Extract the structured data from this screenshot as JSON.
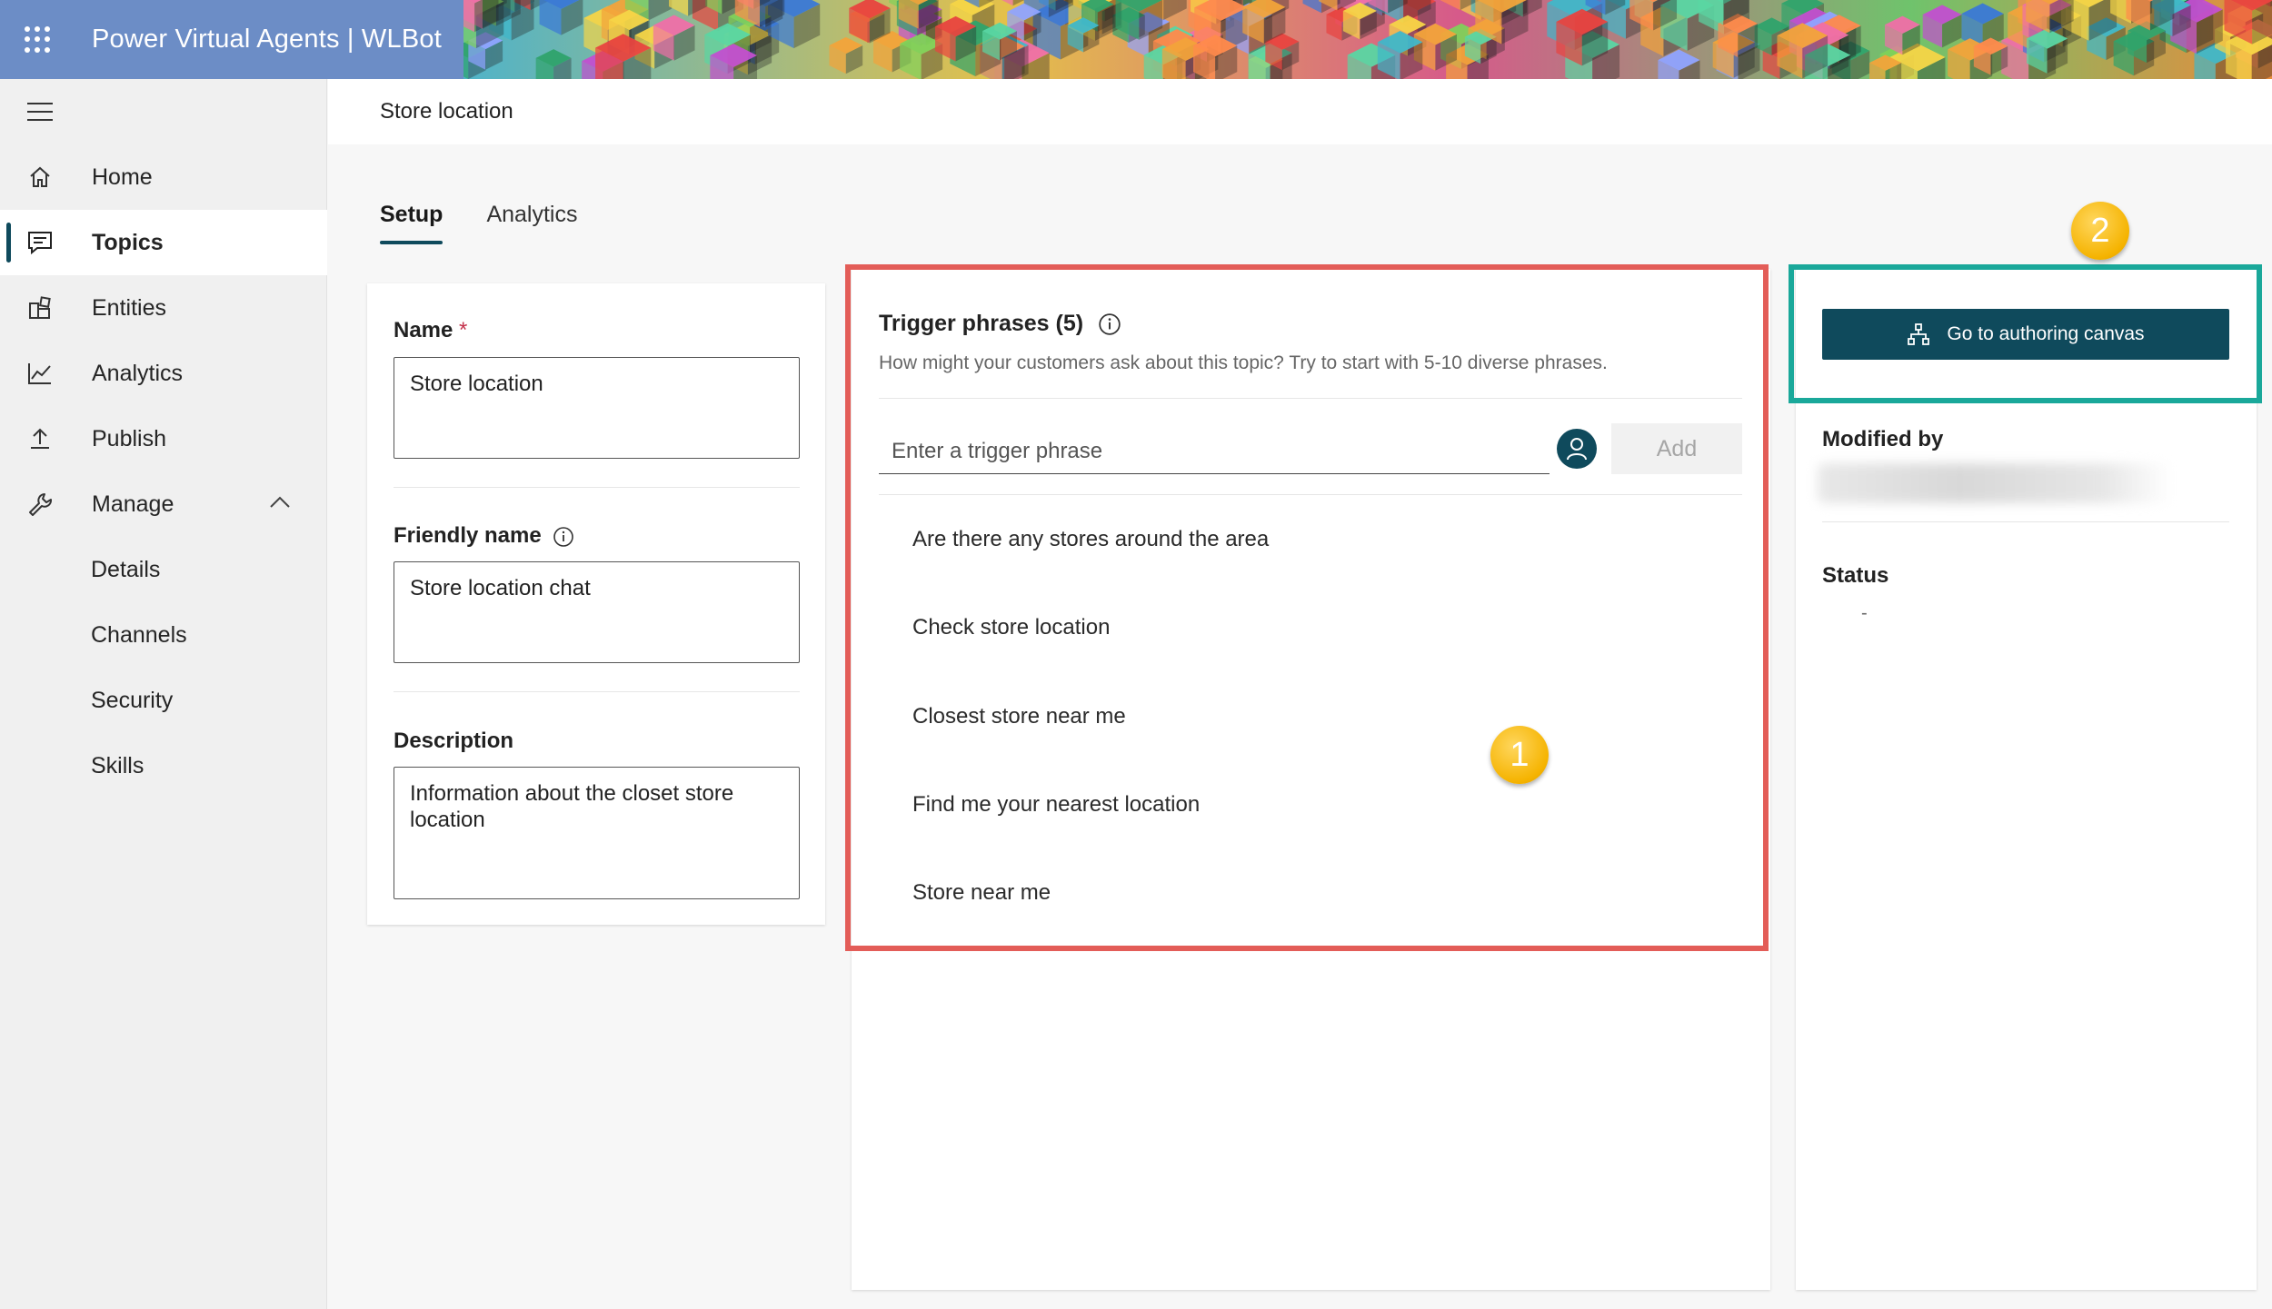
{
  "header": {
    "app_title": "Power Virtual Agents | WLBot",
    "waffle_icon": "waffle-icon"
  },
  "nav": {
    "items": [
      {
        "label": "Home",
        "icon": "home-icon"
      },
      {
        "label": "Topics",
        "icon": "chat-icon",
        "active": true
      },
      {
        "label": "Entities",
        "icon": "entities-icon"
      },
      {
        "label": "Analytics",
        "icon": "analytics-icon"
      },
      {
        "label": "Publish",
        "icon": "publish-icon"
      },
      {
        "label": "Manage",
        "icon": "wrench-icon",
        "expanded": true
      }
    ],
    "sub_items": [
      {
        "label": "Details"
      },
      {
        "label": "Channels"
      },
      {
        "label": "Security"
      },
      {
        "label": "Skills"
      }
    ]
  },
  "page": {
    "title": "Store location",
    "tabs": [
      {
        "label": "Setup",
        "active": true
      },
      {
        "label": "Analytics"
      }
    ]
  },
  "setup_form": {
    "name_label": "Name",
    "name_required": "*",
    "name_value": "Store location",
    "friendly_name_label": "Friendly name",
    "friendly_name_value": "Store location chat",
    "description_label": "Description",
    "description_value": "Information about the closet store location"
  },
  "trigger_phrases": {
    "title": "Trigger phrases (5)",
    "hint": "How might your customers ask about this topic? Try to start with 5-10 diverse phrases.",
    "input_placeholder": "Enter a trigger phrase",
    "add_label": "Add",
    "phrases": [
      "Are there any stores around the area",
      "Check store location",
      "Closest store near me",
      "Find me your nearest location",
      "Store near me"
    ]
  },
  "right_panel": {
    "canvas_button_label": "Go to authoring canvas",
    "modified_by_label": "Modified by",
    "status_label": "Status",
    "status_value": "-"
  },
  "annotations": {
    "badge_1": "1",
    "badge_2": "2"
  },
  "colors": {
    "accent": "#0f4a5c",
    "highlight_red": "#e35d58",
    "highlight_teal": "#1aa89a",
    "badge_yellow": "#f5b300"
  }
}
